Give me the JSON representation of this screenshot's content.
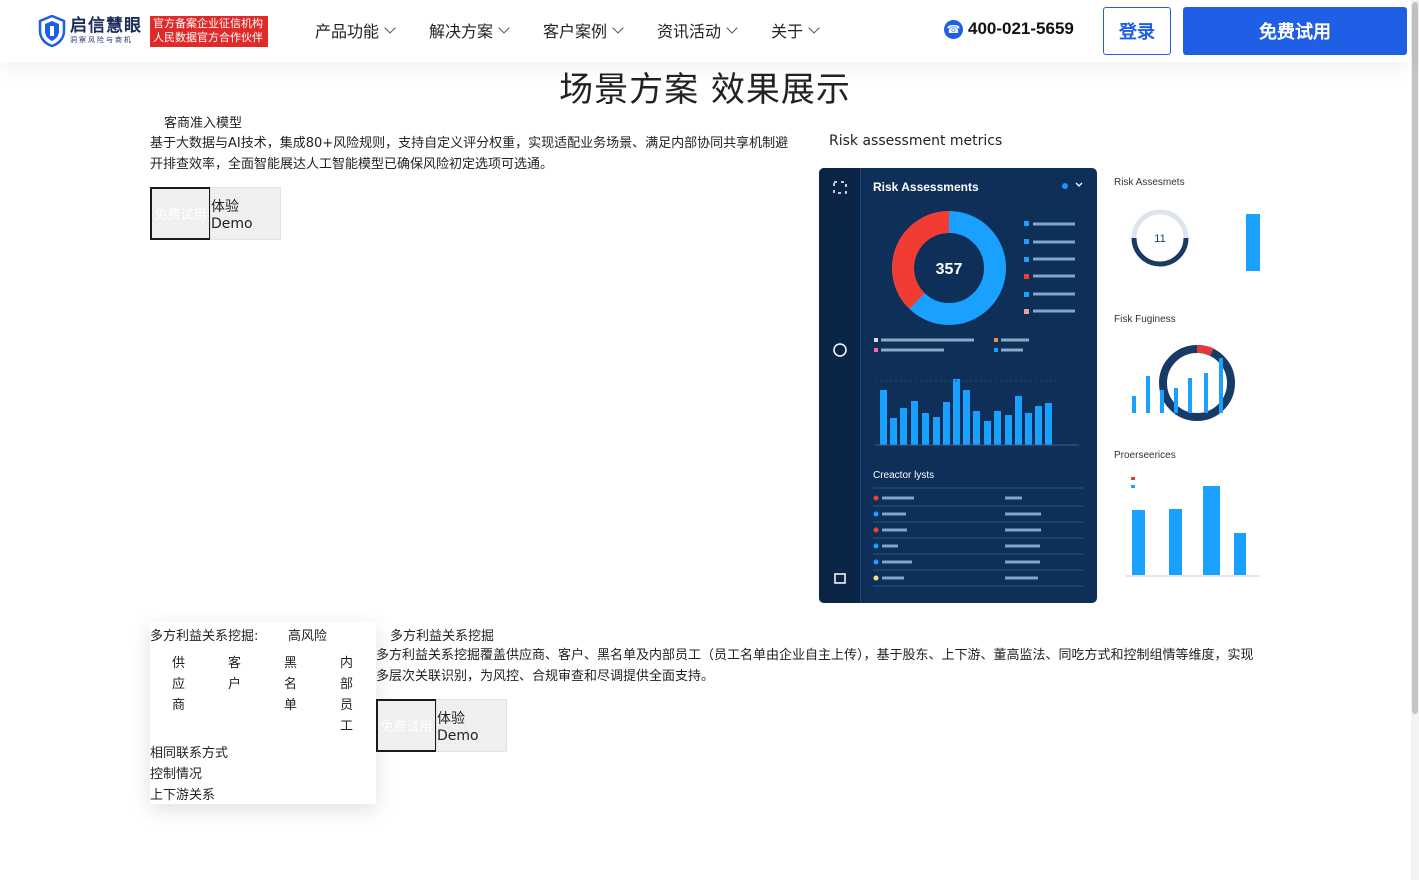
{
  "header": {
    "logo_name": "启信慧眼",
    "logo_slogan": "洞察风险与商机",
    "badge_line1": "官方备案企业征信机构",
    "badge_line2": "人民数据官方合作伙伴",
    "nav": [
      "产品功能",
      "解决方案",
      "客户案例",
      "资讯活动",
      "关于"
    ],
    "phone": "400-021-5659",
    "login_label": "登录",
    "trial_label": "免费试用"
  },
  "section_title": "场景方案 效果展示",
  "block1": {
    "subtitle": "客商准入模型",
    "description": "基于大数据与AI技术，集成80+风险规则，支持自定义评分权重，实现适配业务场景、满足内部协同共享机制避开排查效率，全面智能展达人工智能模型已确保风险初定选项可选通。",
    "trial_label": "免费试用",
    "demo_label": "体验Demo",
    "chart_caption": "Risk assessment metrics"
  },
  "dashboard": {
    "title": "Risk Assessments",
    "center_value": "357",
    "section": "Creactor lysts",
    "side_titles": [
      "Risk Assesmets",
      "Fisk Fuginess",
      "Proerseerices"
    ],
    "side_gauge_value": "11"
  },
  "block2": {
    "popover_head": "多方利益关系挖掘:",
    "popover_risk": "高风险",
    "columns": [
      "供应商",
      "客户",
      "黑名单",
      "内部员工"
    ],
    "lines": [
      "相同联系方式",
      "控制情况",
      "上下游关系"
    ],
    "title": "多方利益关系挖掘",
    "description": "多方利益关系挖掘覆盖供应商、客户、黑名单及内部员工（员工名单由企业自主上传），基于股东、上下游、董高监法、同吃方式和控制组情等维度，实现多层次关联识别，为风控、合规审查和尽调提供全面支持。",
    "trial_label": "免费试用",
    "demo_label": "体验Demo"
  },
  "colors": {
    "brand_blue": "#1f5fe6",
    "badge_red": "#e02a2a",
    "dash_bg": "#0e2f57"
  }
}
